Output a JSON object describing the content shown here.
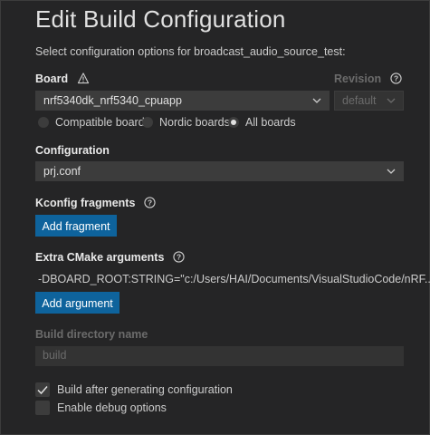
{
  "title": "Edit Build Configuration",
  "subtitle": "Select configuration options for broadcast_audio_source_test:",
  "board": {
    "label": "Board",
    "selected": "nrf5340dk_nrf5340_cpuapp",
    "filters": [
      {
        "label": "Compatible boards",
        "checked": false
      },
      {
        "label": "Nordic boards",
        "checked": false
      },
      {
        "label": "All boards",
        "checked": true
      }
    ]
  },
  "revision": {
    "label": "Revision",
    "selected": "default"
  },
  "configuration": {
    "label": "Configuration",
    "selected": "prj.conf"
  },
  "kconfig": {
    "label": "Kconfig fragments",
    "button": "Add fragment"
  },
  "cmake": {
    "label": "Extra CMake arguments",
    "value": "-DBOARD_ROOT:STRING=\"c:/Users/HAI/Documents/VisualStudioCode/nRF...",
    "button": "Add argument"
  },
  "build_dir": {
    "label": "Build directory name",
    "placeholder": "build"
  },
  "options": {
    "build_after": {
      "label": "Build after generating configuration",
      "checked": true
    },
    "debug": {
      "label": "Enable debug options",
      "checked": false
    }
  },
  "colors": {
    "background": "#252526",
    "button": "#0e639c",
    "input": "#3c3c3c",
    "disabled_text": "#6b6b6b"
  }
}
